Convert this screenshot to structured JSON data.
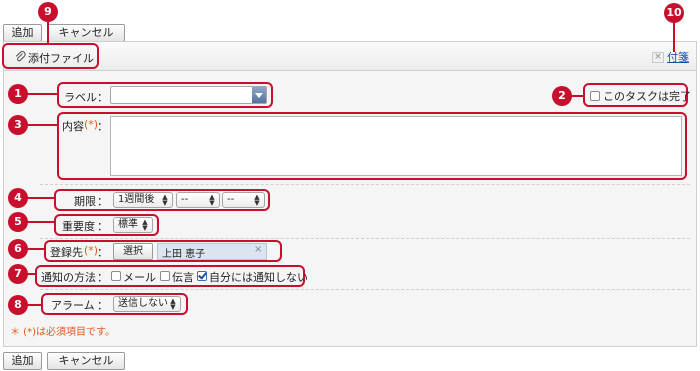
{
  "toolbar": {
    "add_label": "追加",
    "cancel_label": "キャンセル"
  },
  "attachments": {
    "attach_label": "添付ファイル",
    "sticky_label": "付箋",
    "close_glyph": "×"
  },
  "badges": [
    "1",
    "2",
    "3",
    "4",
    "5",
    "6",
    "7",
    "8",
    "9",
    "10"
  ],
  "form": {
    "label_field": {
      "label": "ラベル",
      "colon": "：",
      "value": ""
    },
    "complete_checkbox": {
      "label": "このタスクは完了",
      "checked": false
    },
    "content_field": {
      "label": "内容",
      "required_mark": "(*)",
      "colon": "：",
      "value": ""
    },
    "deadline": {
      "label": "期限",
      "colon": "：",
      "period_value": "1週間後",
      "second_value": "--",
      "third_value": "--"
    },
    "importance": {
      "label": "重要度",
      "colon": "：",
      "value": "標準"
    },
    "assignee": {
      "label": "登録先",
      "required_mark": "(*)",
      "colon": "：",
      "select_button": "選択",
      "user": "上田 恵子",
      "remove_glyph": "×"
    },
    "notification": {
      "label": "通知の方法",
      "colon": "：",
      "options": [
        {
          "label": "メール",
          "checked": false
        },
        {
          "label": "伝言",
          "checked": false
        },
        {
          "label": "自分には通知しない",
          "checked": true
        }
      ]
    },
    "alarm": {
      "label": "アラーム",
      "colon": "：",
      "value": "送信しない"
    }
  },
  "footer_note": {
    "required_note": "＊ (*)は必須項目です。"
  },
  "colors": {
    "highlight": "#c8102e",
    "required": "#e05a1a",
    "link": "#1a4fb0"
  },
  "icons": {
    "attach": "paperclip-icon",
    "dropdown": "dropdown-arrow-icon",
    "close": "close-icon"
  }
}
